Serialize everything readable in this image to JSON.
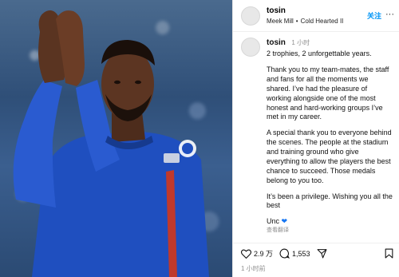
{
  "post": {
    "header": {
      "username": "tosin",
      "music_artist": "Meek Mill",
      "music_separator": "•",
      "music_track": "Cold Hearted II",
      "follow_label": "关注",
      "more_label": "···"
    },
    "caption": {
      "username": "tosin",
      "time": "1 小时",
      "paragraphs": [
        "2 trophies, 2 unforgettable years.",
        "Thank you to my team-mates, the staff and fans for all the moments we shared. I’ve had the pleasure of working alongside one of the most honest and hard-working groups I’ve met in my career.",
        "A special thank you to everyone behind the scenes. The people at the stadium and training ground who give everything to allow the players the best chance to succeed. Those medals belong to you too.",
        "It’s been a privilege. Wishing you all the best"
      ],
      "signoff": "Unc",
      "translate_label": "查看翻译"
    },
    "actions": {
      "likes": "2.9 万",
      "comments": "1,553"
    },
    "footer_time": "1 小时前"
  },
  "colors": {
    "follow": "#0095f6",
    "heart": "#1877f2",
    "muted": "#8e8e8e",
    "kit_blue": "#1f4fbf"
  },
  "icons": [
    "heart-icon",
    "comment-icon",
    "share-icon",
    "bookmark-icon",
    "more-icon"
  ]
}
